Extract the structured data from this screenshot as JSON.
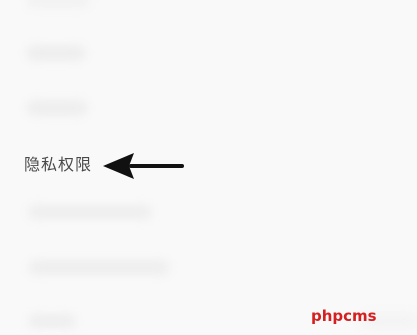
{
  "menu": {
    "privacy_label": "隐私权限"
  },
  "annotation": {
    "icon": "left-arrow-icon"
  },
  "watermark": {
    "text": "phpcms"
  },
  "colors": {
    "background": "#f9f9f9",
    "label": "#4a4a4a",
    "arrow": "#111111",
    "watermark": "#d42020"
  }
}
